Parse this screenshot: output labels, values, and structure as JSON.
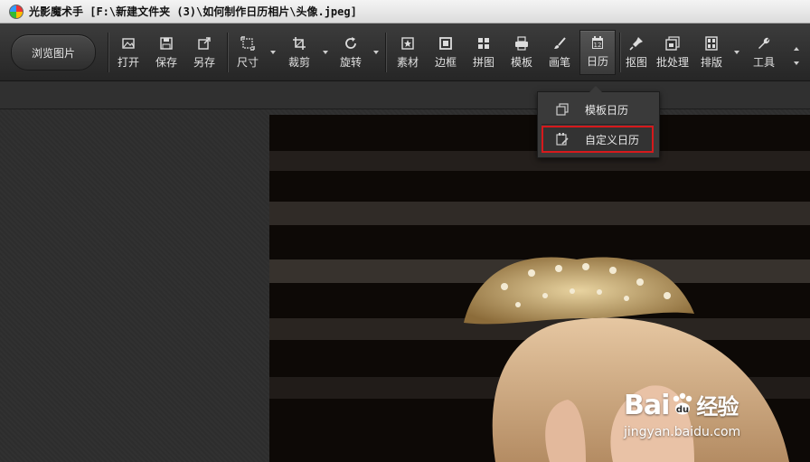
{
  "window": {
    "title": "光影魔术手 [F:\\新建文件夹 (3)\\如何制作日历相片\\头像.jpeg]"
  },
  "toolbar": {
    "browse_label": "浏览图片",
    "tools": [
      {
        "label": "打开",
        "icon": "open-image-icon"
      },
      {
        "label": "保存",
        "icon": "save-icon"
      },
      {
        "label": "另存",
        "icon": "save-as-icon"
      },
      {
        "label": "尺寸",
        "icon": "resize-icon"
      },
      {
        "label": "裁剪",
        "icon": "crop-icon"
      },
      {
        "label": "旋转",
        "icon": "rotate-icon"
      },
      {
        "label": "素材",
        "icon": "material-icon"
      },
      {
        "label": "边框",
        "icon": "frame-icon"
      },
      {
        "label": "拼图",
        "icon": "collage-icon"
      },
      {
        "label": "模板",
        "icon": "template-icon"
      },
      {
        "label": "画笔",
        "icon": "brush-icon"
      },
      {
        "label": "日历",
        "icon": "calendar-icon"
      },
      {
        "label": "抠图",
        "icon": "cutout-icon"
      },
      {
        "label": "批处理",
        "icon": "batch-icon"
      },
      {
        "label": "排版",
        "icon": "layout-icon"
      },
      {
        "label": "工具",
        "icon": "wrench-icon"
      }
    ],
    "calendar_icon_number": "12"
  },
  "calendar_menu": {
    "items": [
      {
        "label": "模板日历",
        "icon": "template-calendar-icon"
      },
      {
        "label": "自定义日历",
        "icon": "custom-calendar-icon",
        "highlighted": true
      }
    ]
  },
  "watermark": {
    "brand": "Bai",
    "brand_suffix": "经验",
    "url": "jingyan.baidu.com"
  },
  "colors": {
    "highlight_border": "#d6191c",
    "toolbar_bg": "#2e2e2e"
  }
}
